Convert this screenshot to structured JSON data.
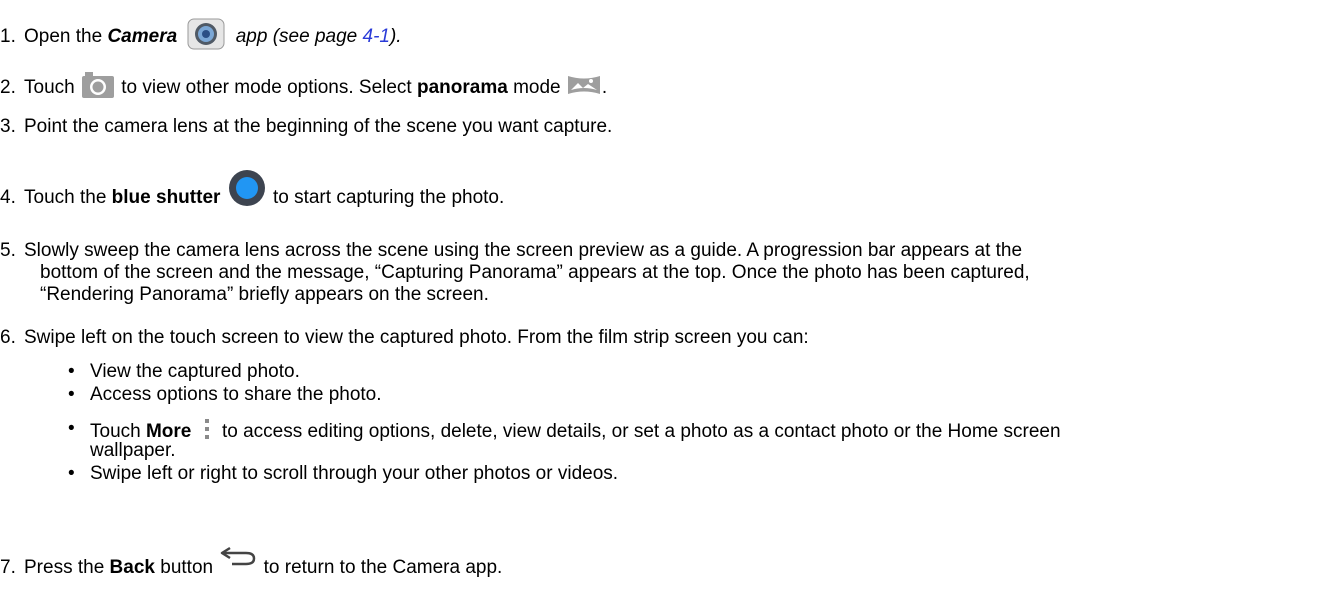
{
  "steps": [
    {
      "num": "1.",
      "pre": "Open the ",
      "em": "Camera",
      "post_italic": " app (see page ",
      "link": "4-1",
      "close": ")."
    },
    {
      "num": "2.",
      "pre": "Touch ",
      "mid": " to view other mode options.  Select ",
      "bold": "panorama",
      "post": " mode ",
      "end": "."
    },
    {
      "num": "3.",
      "text": "Point the camera lens at the beginning of the scene you want capture."
    },
    {
      "num": "4.",
      "pre": "Touch the ",
      "bold": "blue shutter",
      "post": " to start capturing the photo."
    },
    {
      "num": "5.",
      "line1": "Slowly sweep the camera lens across the scene using the screen preview as a guide. A progression bar appears at the",
      "line2": "bottom of the screen and the message, “Capturing Panorama” appears at the top. Once the photo has been captured,",
      "line3": "“Rendering Panorama” briefly appears on the screen."
    },
    {
      "num": "6.",
      "text": "Swipe left on the touch screen to view the captured photo.  From the film strip screen you can:"
    },
    {
      "num": "7.",
      "pre": "Press the ",
      "bold": "Back",
      "post": " button ",
      "end": " to return to the Camera app."
    }
  ],
  "bullets": {
    "symbol": "•",
    "b1": "View the captured photo.",
    "b2": "Access options to share the photo.",
    "b3_pre": "Touch  ",
    "b3_bold": "More",
    "b3_post": "  to access editing options, delete, view details, or set a photo as a contact photo or the Home screen",
    "b3_cont": "wallpaper.",
    "b4": "Swipe left or right to scroll through your other photos or videos."
  },
  "icons": {
    "camera_app": "camera-app-icon",
    "camera_mode": "camera-mode-icon",
    "panorama": "panorama-mode-icon",
    "shutter": "blue-shutter-icon",
    "more": "more-vertical-icon",
    "back": "back-arrow-icon"
  },
  "colors": {
    "link": "#2a3bd8",
    "shutter": "#2196f3",
    "icon_gray": "#9e9e9e"
  }
}
